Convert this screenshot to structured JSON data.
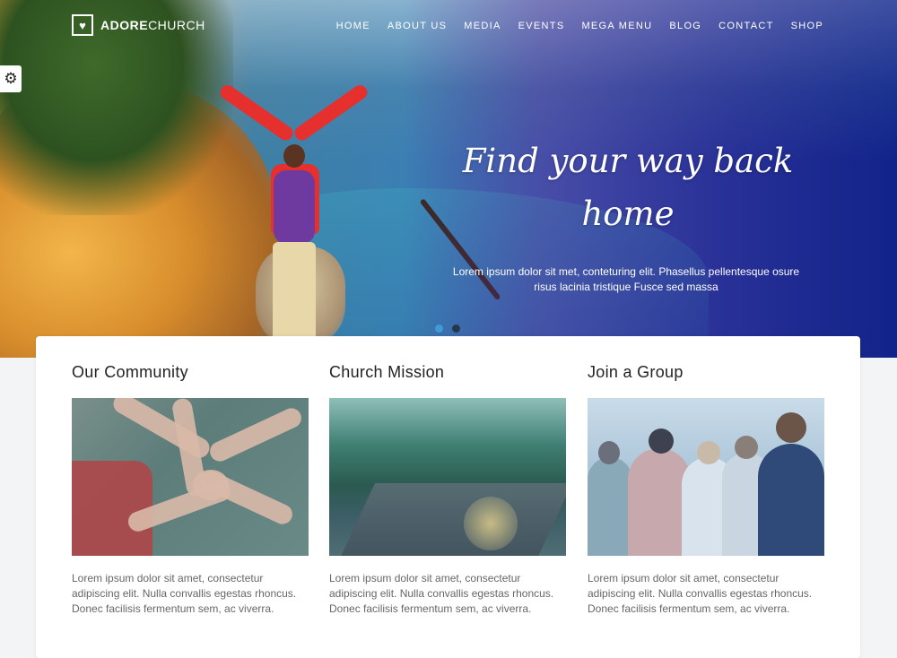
{
  "header": {
    "logo_bold": "ADORE",
    "logo_light": "CHURCH",
    "nav": [
      "HOME",
      "ABOUT US",
      "MEDIA",
      "EVENTS",
      "MEGA MENU",
      "BLOG",
      "CONTACT",
      "SHOP"
    ]
  },
  "hero": {
    "heading": "Find your way back home",
    "subtext": "Lorem ipsum dolor sit met, conteturing elit. Phasellus pellentesque osure risus lacinia tristique Fusce sed massa",
    "slides_total": 2,
    "active_slide": 1
  },
  "sections": [
    {
      "title": "Our Community",
      "image": "hands-together-photo",
      "text": "Lorem ipsum dolor sit amet, consectetur adipiscing elit. Nulla convallis egestas rhoncus. Donec facilisis fermentum sem, ac viverra."
    },
    {
      "title": "Church Mission",
      "image": "forest-road-photo",
      "text": "Lorem ipsum dolor sit amet, consectetur adipiscing elit. Nulla convallis egestas rhoncus. Donec facilisis fermentum sem, ac viverra."
    },
    {
      "title": "Join a Group",
      "image": "friends-group-photo",
      "text": "Lorem ipsum dolor sit amet, consectetur adipiscing elit. Nulla convallis egestas rhoncus. Donec facilisis fermentum sem, ac viverra."
    }
  ],
  "icons": {
    "logo": "heart-icon",
    "settings": "gear-icon"
  },
  "colors": {
    "accent_dot": "#3f9ad8",
    "hero_deep": "#1a2a88"
  }
}
